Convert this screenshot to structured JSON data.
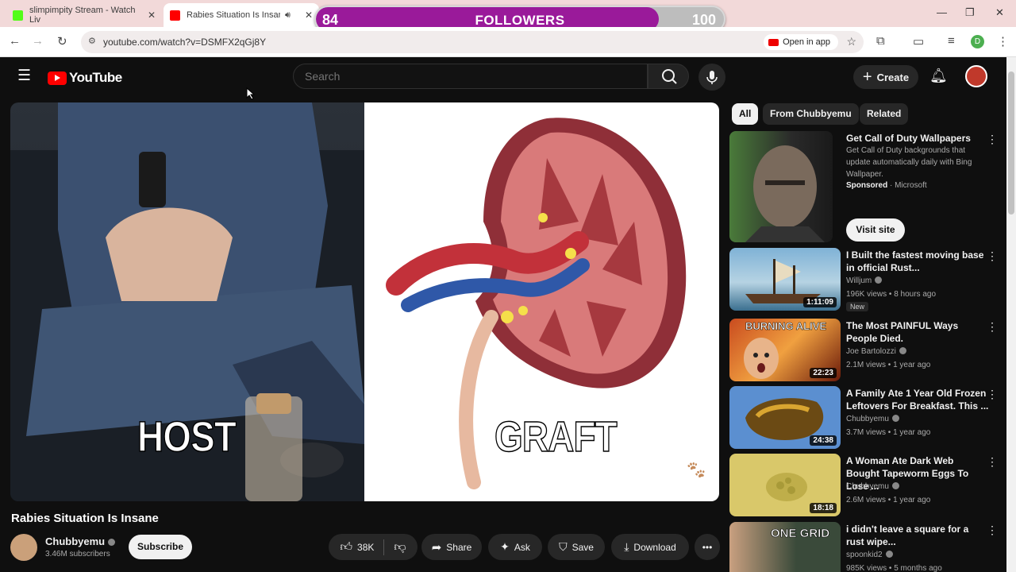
{
  "browser": {
    "tabs": [
      {
        "title": "slimpimpity Stream - Watch Liv"
      },
      {
        "title": "Rabies Situation Is Insane - "
      }
    ],
    "url": "youtube.com/watch?v=DSMFX2qGj8Y",
    "open_in_app": "Open in app",
    "profile_letter": "D"
  },
  "overlay": {
    "current": "84",
    "label": "FOLLOWERS",
    "goal": "100",
    "progress": 0.84
  },
  "youtube": {
    "logo_text": "YouTube",
    "search_placeholder": "Search",
    "create_label": "Create"
  },
  "video": {
    "caption_left": "HOST",
    "caption_right": "GRAFT",
    "title": "Rabies Situation Is Insane",
    "channel": "Chubbyemu",
    "subscribers": "3.46M subscribers",
    "subscribe_label": "Subscribe",
    "likes": "38K",
    "share_label": "Share",
    "ask_label": "Ask",
    "save_label": "Save",
    "download_label": "Download"
  },
  "sidebar": {
    "chips": [
      "All",
      "From Chubbyemu",
      "Related"
    ],
    "ad": {
      "title": "Get Call of Duty Wallpapers",
      "description": "Get Call of Duty backgrounds that update automatically daily with Bing Wallpaper.",
      "sponsored": "Sponsored",
      "advertiser": "Microsoft",
      "cta": "Visit site"
    },
    "videos": [
      {
        "title": "I Built the fastest moving base in official Rust...",
        "channel": "Willjum",
        "meta": "196K views • 8 hours ago",
        "badge": "New",
        "duration": "1:11:09"
      },
      {
        "title": "The Most PAINFUL Ways People Died.",
        "channel": "Joe Bartolozzi",
        "meta": "2.1M views • 1 year ago",
        "duration": "22:23",
        "thumb_text": "BURNING ALIVE"
      },
      {
        "title": "A Family Ate 1 Year Old Frozen Leftovers For Breakfast. This ...",
        "channel": "Chubbyemu",
        "meta": "3.7M views • 1 year ago",
        "duration": "24:38"
      },
      {
        "title": "A Woman Ate Dark Web Bought Tapeworm Eggs To Lose ...",
        "channel": "Chubbyemu",
        "meta": "2.6M views • 1 year ago",
        "duration": "18:18"
      },
      {
        "title": "i didn't leave a square for a rust wipe...",
        "channel": "spoonkid2",
        "meta": "985K views • 5 months ago",
        "thumb_text": "ONE GRID"
      }
    ]
  }
}
